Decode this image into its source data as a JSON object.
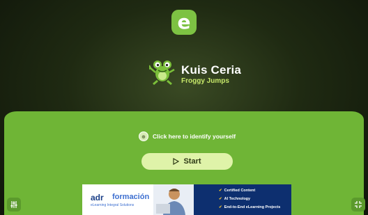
{
  "app": {
    "logo_letter": "e",
    "title": "Kuis Ceria",
    "subtitle": "Froggy Jumps"
  },
  "actions": {
    "identify_label": "Click here to identify yourself",
    "start_label": "Start"
  },
  "banner": {
    "brand": "adr",
    "brand_suffix": "formación",
    "tagline": "eLearning Integral Solutions",
    "features": [
      "Certified Content",
      "AI Technology",
      "End-to-End eLearning Projects"
    ]
  },
  "icons": {
    "settings": "sliders-icon",
    "fullscreen": "fullscreen-icon",
    "play": "play-icon",
    "user": "user-icon"
  }
}
